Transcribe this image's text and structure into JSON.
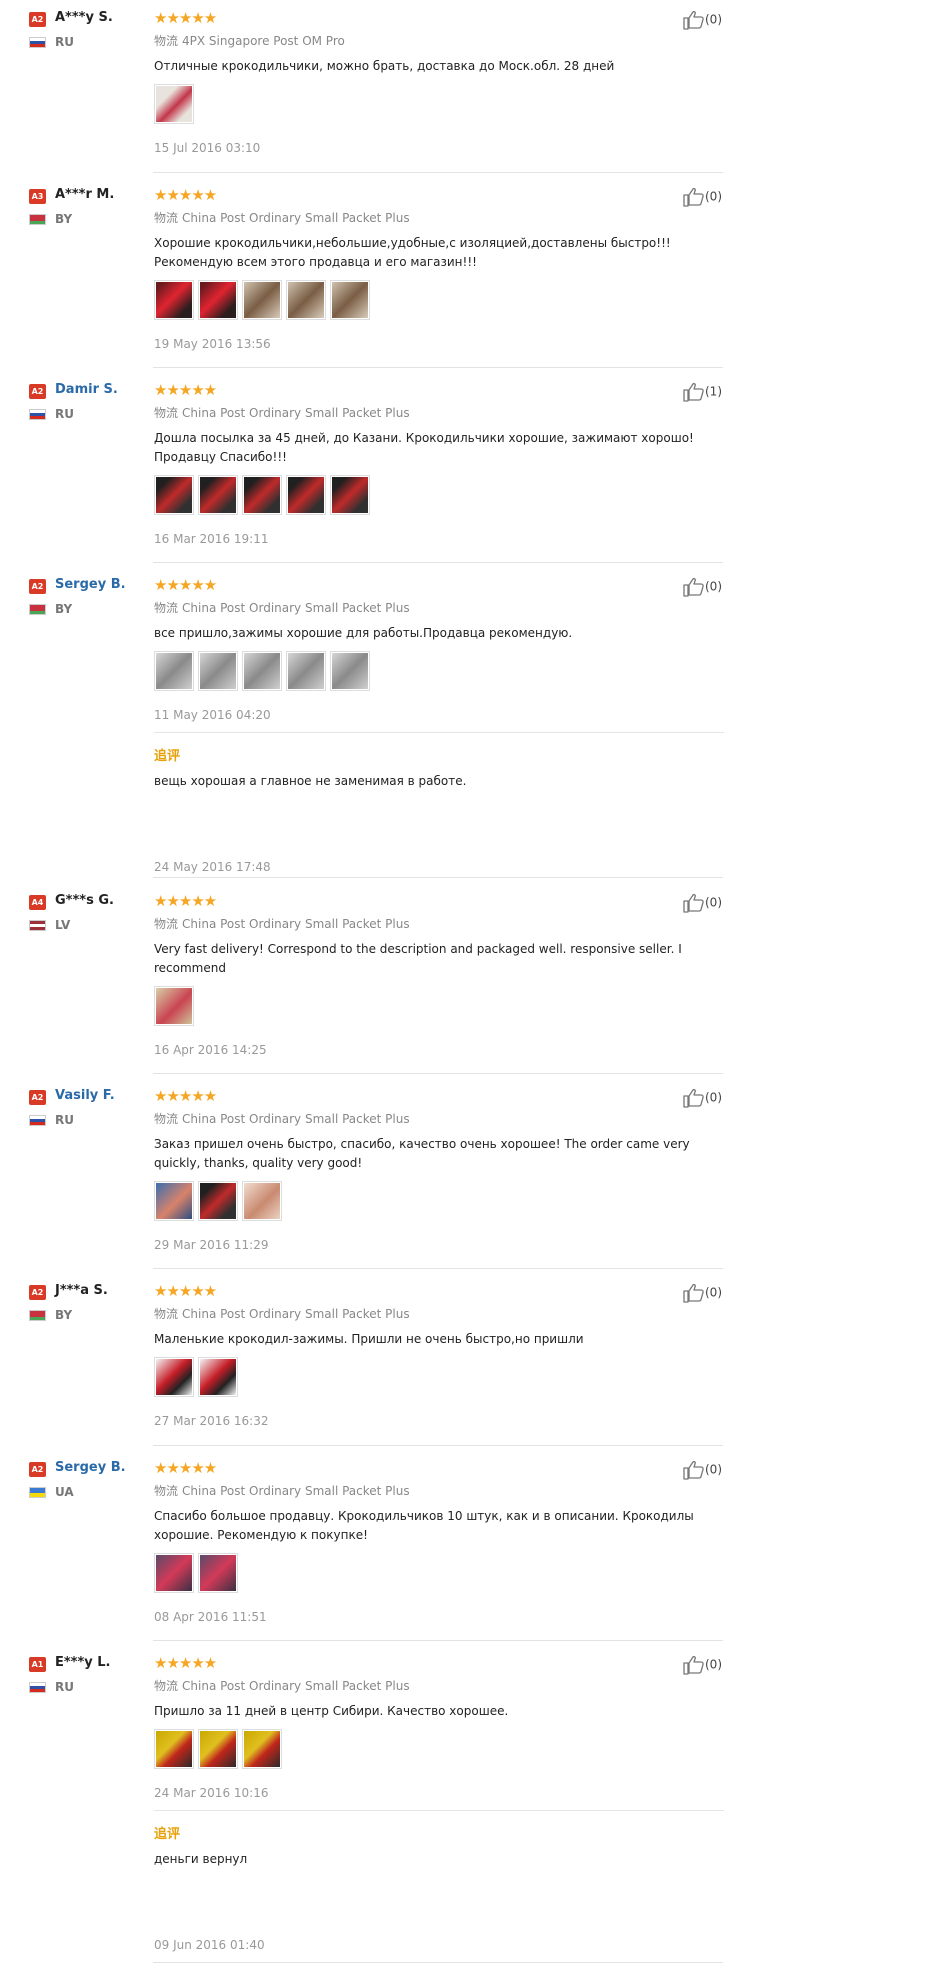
{
  "shipping_label_cn": "物流",
  "followup_label": "追评",
  "reviews": [
    {
      "level": "A2",
      "name": "A***y S.",
      "name_style": "black",
      "country": "RU",
      "flag": "ru",
      "stars": "★★★★★",
      "shipping": "4PX Singapore Post OM Pro",
      "text": "Отличные крокодильчики, можно брать, доставка до Моск.обл. 28 дней",
      "thumbs": [
        "pink"
      ],
      "date": "15 Jul 2016 03:10",
      "likes": "(0)"
    },
    {
      "level": "A3",
      "name": "A***r M.",
      "name_style": "black",
      "country": "BY",
      "flag": "by",
      "stars": "★★★★★",
      "shipping": "China Post Ordinary Small Packet Plus",
      "text": "Хорошие крокодильчики,небольшие,удобные,с изоляцией,доставлены быстро!!! Рекомендую всем этого продавца и его магазин!!!",
      "thumbs": [
        "red",
        "red",
        "tan",
        "tan",
        "tan"
      ],
      "date": "19 May 2016 13:56",
      "likes": "(0)"
    },
    {
      "level": "A2",
      "name": "Damir S.",
      "name_style": "blue",
      "country": "RU",
      "flag": "ru",
      "stars": "★★★★★",
      "shipping": "China Post Ordinary Small Packet Plus",
      "text": "Дошла посылка за 45 дней, до Казани. Крокодильчики хорошие, зажимают хорошо! Продавцу Спасибо!!!",
      "thumbs": [
        "dark",
        "dark",
        "dark",
        "dark",
        "dark"
      ],
      "date": "16 Mar 2016 19:11",
      "likes": "(1)"
    },
    {
      "level": "A2",
      "name": "Sergey B.",
      "name_style": "blue",
      "country": "BY",
      "flag": "by",
      "stars": "★★★★★",
      "shipping": "China Post Ordinary Small Packet Plus",
      "text": "все пришло,зажимы хорошие для работы.Продавца рекомендую.",
      "thumbs": [
        "grey",
        "grey",
        "grey",
        "grey",
        "grey"
      ],
      "date": "11 May 2016 04:20",
      "likes": "(0)",
      "followup": {
        "text": "вещь хорошая а главное не заменимая в работе.",
        "date": "24 May 2016 17:48"
      }
    },
    {
      "level": "A4",
      "name": "G***s G.",
      "name_style": "black",
      "country": "LV",
      "flag": "lv",
      "stars": "★★★★★",
      "shipping": "China Post Ordinary Small Packet Plus",
      "text": "Very fast delivery! Correspond to the description and packaged well. responsive seller. I recommend",
      "thumbs": [
        "beige"
      ],
      "date": "16 Apr 2016 14:25",
      "likes": "(0)"
    },
    {
      "level": "A2",
      "name": "Vasily F.",
      "name_style": "blue",
      "country": "RU",
      "flag": "ru",
      "stars": "★★★★★",
      "shipping": "China Post Ordinary Small Packet Plus",
      "text": "Заказ пришел очень быстро, спасибо, качество очень хорошее! The order came very quickly, thanks, quality very good!",
      "thumbs": [
        "blue",
        "dark",
        "skin"
      ],
      "date": "29 Mar 2016 11:29",
      "likes": "(0)"
    },
    {
      "level": "A2",
      "name": "J***a S.",
      "name_style": "black",
      "country": "BY",
      "flag": "by",
      "stars": "★★★★★",
      "shipping": "China Post Ordinary Small Packet Plus",
      "text": "Маленькие крокодил-зажимы. Пришли не очень быстро,но пришли",
      "thumbs": [
        "white",
        "white"
      ],
      "date": "27 Mar 2016 16:32",
      "likes": "(0)"
    },
    {
      "level": "A2",
      "name": "Sergey B.",
      "name_style": "blue",
      "country": "UA",
      "flag": "ua",
      "stars": "★★★★★",
      "shipping": "China Post Ordinary Small Packet Plus",
      "text": "Спасибо большое продавцу. Крокодильчиков 10 штук, как и в описании. Крокодилы хорошие. Рекомендую к покупке!",
      "thumbs": [
        "purple",
        "purple"
      ],
      "date": "08 Apr 2016 11:51",
      "likes": "(0)"
    },
    {
      "level": "A1",
      "name": "E***y L.",
      "name_style": "black",
      "country": "RU",
      "flag": "ru",
      "stars": "★★★★★",
      "shipping": "China Post Ordinary Small Packet Plus",
      "text": "Пришло за 11 дней в центр Сибири. Качество хорошее.",
      "thumbs": [
        "yellow",
        "yellow",
        "yellow"
      ],
      "date": "24 Mar 2016 10:16",
      "likes": "(0)",
      "followup": {
        "text": "деньги вернул",
        "date": "09 Jun 2016 01:40"
      }
    }
  ]
}
